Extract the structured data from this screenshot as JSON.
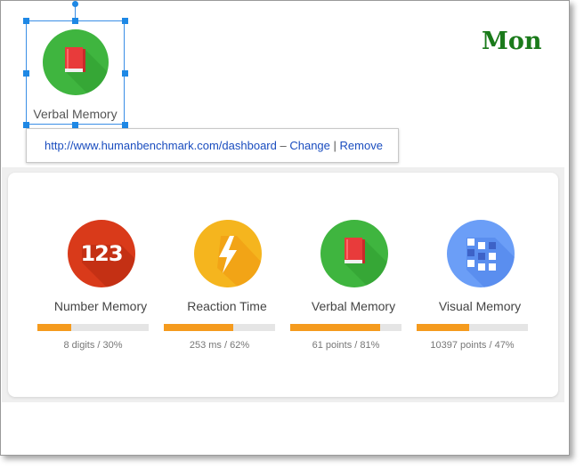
{
  "header": {
    "title": "Mon"
  },
  "selected": {
    "label": "Verbal Memory",
    "icon": "book-icon"
  },
  "link_popup": {
    "url": "http://www.humanbenchmark.com/dashboard",
    "separator": "–",
    "change": "Change",
    "pipe": "|",
    "remove": "Remove"
  },
  "tiles": [
    {
      "name": "Number Memory",
      "stat": "8 digits / 30%",
      "percent": 30,
      "color": "#d93a1a",
      "icon_text": "123",
      "icon": "number-icon"
    },
    {
      "name": "Reaction Time",
      "stat": "253 ms / 62%",
      "percent": 62,
      "color": "#f5b51e",
      "icon": "lightning-icon"
    },
    {
      "name": "Verbal Memory",
      "stat": "61 points / 81%",
      "percent": 81,
      "color": "#3fb53f",
      "icon": "book-icon"
    },
    {
      "name": "Visual Memory",
      "stat": "10397 points / 47%",
      "percent": 47,
      "color": "#6b9ef7",
      "icon": "grid-icon"
    }
  ],
  "colors": {
    "accent_bar": "#f59b1e",
    "link": "#1a4dbf",
    "title": "#1a7a1a"
  }
}
